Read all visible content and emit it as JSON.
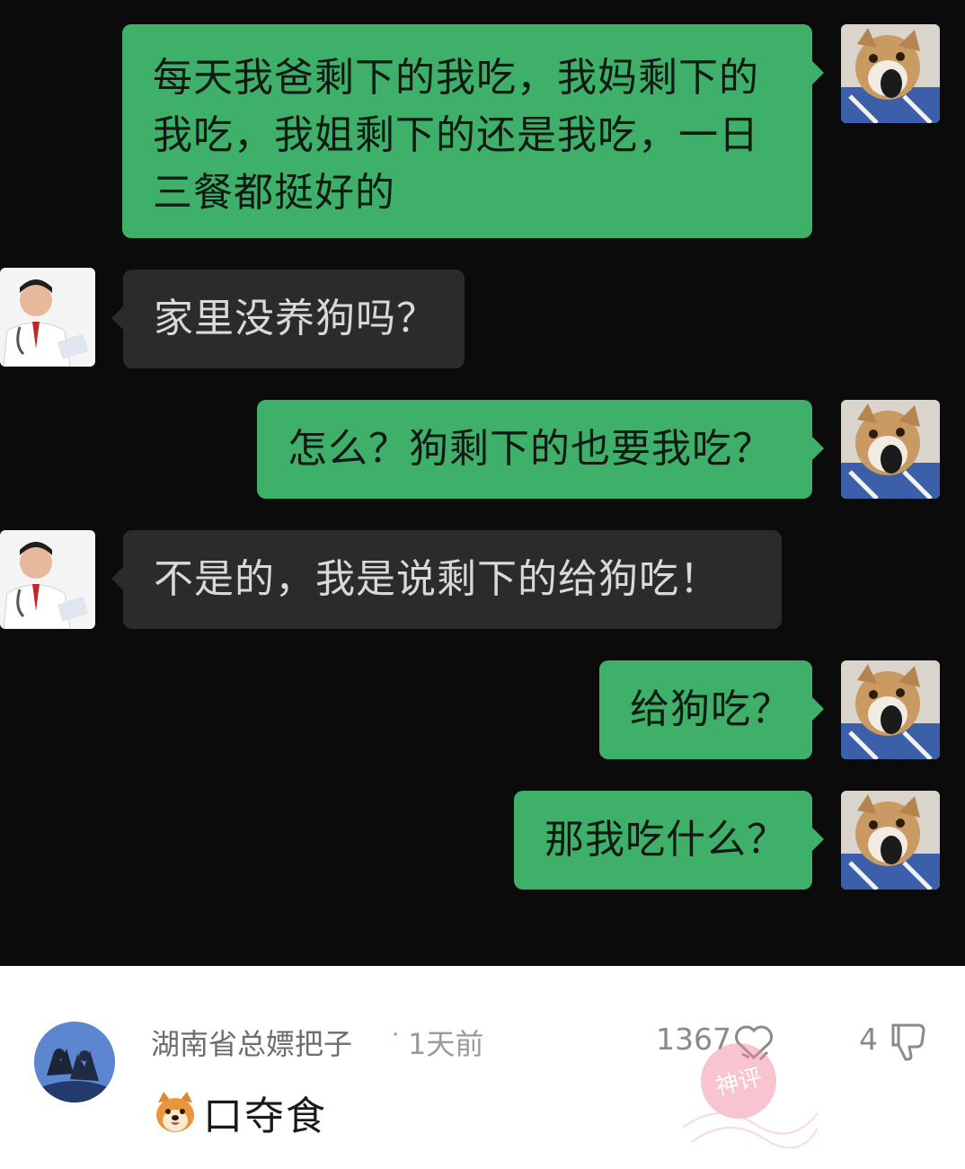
{
  "chat": {
    "messages": [
      {
        "side": "sent",
        "sender": "shiba",
        "text_lines": [
          "每天我爸剩下的我吃，我妈剩下的",
          "我吃，我姐剩下的还是我吃，一日",
          "三餐都挺好的"
        ]
      },
      {
        "side": "received",
        "sender": "doctor",
        "text": "家里没养狗吗？"
      },
      {
        "side": "sent",
        "sender": "shiba",
        "text": "怎么？狗剩下的也要我吃？"
      },
      {
        "side": "received",
        "sender": "doctor",
        "text": "不是的，我是说剩下的给狗吃！"
      },
      {
        "side": "sent",
        "sender": "shiba",
        "text": "给狗吃？"
      },
      {
        "side": "sent",
        "sender": "shiba",
        "text": "那我吃什么？"
      }
    ],
    "colors": {
      "background": "#0b0b0c",
      "sent_bubble": "#3fb06a",
      "received_bubble": "#2b2b2e"
    }
  },
  "comment": {
    "username": "湖南省总嫖把子",
    "separator": "·",
    "time": "1天前",
    "likes": "1367",
    "dislikes": "4",
    "emoji_icon": "shiba-dog-emoji",
    "text": "口夺食",
    "badge": "神评"
  }
}
